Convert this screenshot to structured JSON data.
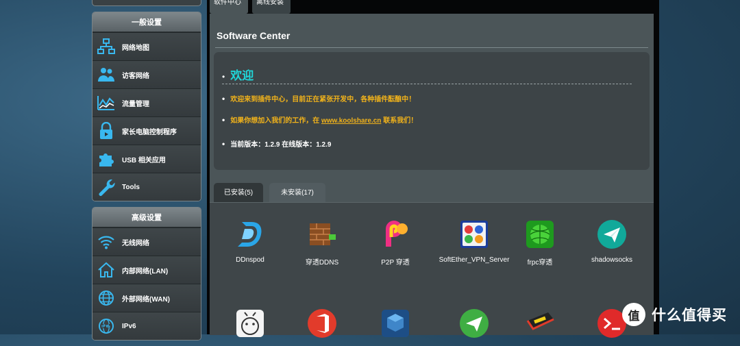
{
  "top_tabs": [
    "软件中心",
    "离线安装"
  ],
  "sidebar": {
    "general_header": "一般设置",
    "general_items": [
      "网络地图",
      "访客网络",
      "流量管理",
      "家长电脑控制程序",
      "USB 相关应用",
      "Tools"
    ],
    "advanced_header": "高级设置",
    "advanced_items": [
      "无线网络",
      "内部网络(LAN)",
      "外部网络(WAN)",
      "IPv6"
    ]
  },
  "content": {
    "title": "Software Center",
    "welcome_title": "欢迎",
    "line1": "欢迎来到插件中心，目前正在紧张开发中，各种插件酝酿中！",
    "line2_pre": "如果你想加入我们的工作，在",
    "line2_link": "www.koolshare.cn",
    "line2_post": "联系我们！",
    "line3": "当前版本：1.2.9 在线版本：1.2.9"
  },
  "tabs": {
    "installed": "已安装(5)",
    "available": "未安装(17)"
  },
  "apps": [
    "DDnspod",
    "穿透DDNS",
    "P2P 穿透",
    "SoftEther_VPN_Server",
    "frpc穿透",
    "shadowsocks"
  ],
  "row2_icons": [
    "smiley-icon",
    "office-icon",
    "box-icon",
    "paper-plane-icon",
    "ram-icon",
    "terminal-icon"
  ],
  "colors": {
    "accent_cyan": "#20d6d8",
    "accent_orange": "#f2b31a"
  },
  "watermark": {
    "badge": "值",
    "text": "什么值得买"
  }
}
